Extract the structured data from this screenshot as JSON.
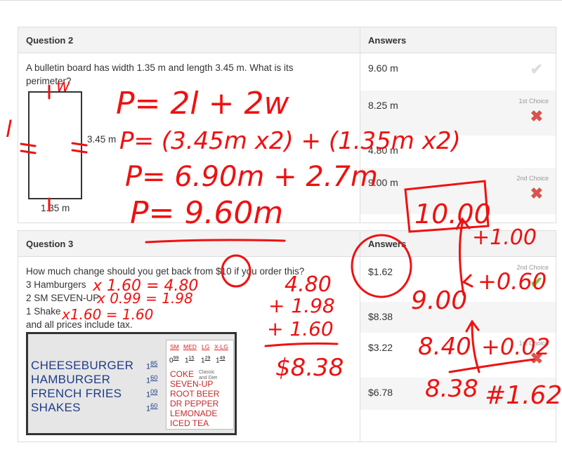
{
  "q2": {
    "title": "Question 2",
    "answers_header": "Answers",
    "text": "A bulletin board has width 1.35 m and length 3.45 m. What is its perimeter?",
    "length_label": "3.45 m",
    "width_label": "1.35 m",
    "answers": [
      {
        "value": "9.60 m",
        "choice": "",
        "mark": "check-gray"
      },
      {
        "value": "8.25 m",
        "choice": "1st Choice",
        "mark": "x-red"
      },
      {
        "value": "4.80 m",
        "choice": "",
        "mark": ""
      },
      {
        "value": "9.00 m",
        "choice": "2nd Choice",
        "mark": "x-red"
      }
    ]
  },
  "q3": {
    "title": "Question 3",
    "answers_header": "Answers",
    "text_lines": [
      "How much change should you get back from $10 if you order this?",
      "3 Hamburgers",
      "2 SM SEVEN-UP",
      "1 Shake",
      "and all prices include tax."
    ],
    "answers": [
      {
        "value": "$1.62",
        "choice": "2nd Choice",
        "mark": "check-green"
      },
      {
        "value": "$8.38",
        "choice": "",
        "mark": ""
      },
      {
        "value": "$3.22",
        "choice": "1st Choice",
        "mark": "x-red"
      },
      {
        "value": "$6.78",
        "choice": "",
        "mark": ""
      }
    ],
    "menu": {
      "food": [
        {
          "name": "CHEESEBURGER",
          "dollars": "1",
          "cents": "85"
        },
        {
          "name": "HAMBURGER",
          "dollars": "1",
          "cents": "60"
        },
        {
          "name": "FRENCH FRIES",
          "dollars": "1",
          "cents": "09"
        },
        {
          "name": "SHAKES",
          "dollars": "1",
          "cents": "60"
        }
      ],
      "sizes": [
        "SM",
        "MED",
        "LG",
        "X-LG"
      ],
      "drink_prices": [
        {
          "dollars": "0",
          "cents": "99"
        },
        {
          "dollars": "1",
          "cents": "15"
        },
        {
          "dollars": "1",
          "cents": "29"
        },
        {
          "dollars": "1",
          "cents": "49"
        }
      ],
      "classic_note": "Classic and Diet",
      "drinks": [
        "COKE",
        "SEVEN-UP",
        "ROOT BEER",
        "DR PEPPER",
        "LEMONADE",
        "ICED TEA"
      ]
    }
  },
  "handwriting": {
    "q2_lines": [
      "P= 2l + 2w",
      "P= (3.45m x2) + (1.35m x2)",
      "P= 6.90m + 2.7m",
      "P= 9.60m"
    ],
    "q2_rect_marks": [
      "l",
      "w"
    ],
    "q3_products": [
      "x 1.60 = 4.80",
      "x 0.99 = 1.98",
      "x1.60 = 1.60"
    ],
    "q3_sum": [
      "4.80",
      "+ 1.98",
      "+ 1.60",
      "$8.38"
    ],
    "q3_change": [
      "10.00",
      "+1.00",
      "9.00",
      "+0.60",
      "8.40",
      "+0.02",
      "8.38",
      "#1.62"
    ]
  },
  "colors": {
    "ink": "#ee1111",
    "header_bg": "#f3f3f3",
    "menu_blue": "#1f3c88",
    "menu_red": "#c62828",
    "check_green": "#7dc242"
  }
}
